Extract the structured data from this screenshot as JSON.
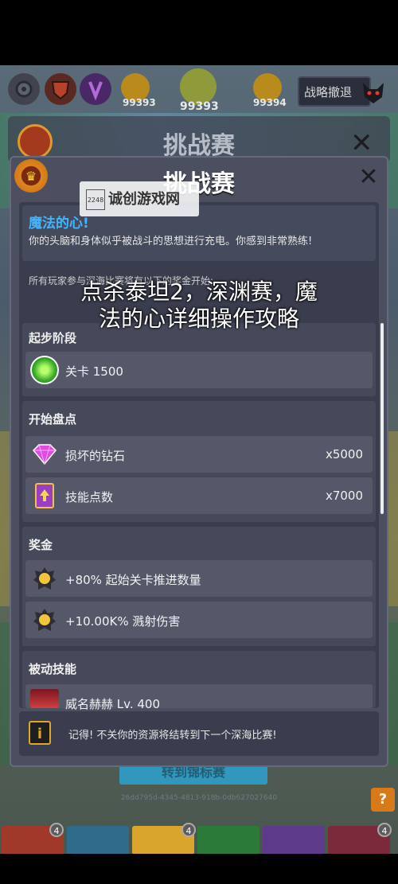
{
  "hud": {
    "coin_left": "99393",
    "coin_center": "99393",
    "coin_right": "99394",
    "retreat_label": "战略撤退"
  },
  "background_title": "挑战赛",
  "dialog": {
    "title": "挑战赛",
    "info_title": "魔法的心!",
    "info_text": "你的头脑和身体似乎被战斗的思想进行充电。你感到非常熟练!",
    "rewards_intro": "所有玩家参与深海比赛将有以下的奖金开始:",
    "start_stage": {
      "title": "起步阶段",
      "row_label": "关卡 1500"
    },
    "start_inventory": {
      "title": "开始盘点",
      "rows": [
        {
          "label": "损坏的钻石",
          "value": "x5000",
          "icon": "diamond-icon"
        },
        {
          "label": "技能点数",
          "value": "x7000",
          "icon": "skill-book-icon"
        }
      ]
    },
    "bonus": {
      "title": "奖金",
      "rows": [
        {
          "label": "+80% 起始关卡推进数量",
          "icon": "hero-token-icon"
        },
        {
          "label": "+10.00K% 溅射伤害",
          "icon": "hero-token-icon"
        }
      ]
    },
    "passive": {
      "title": "被动技能",
      "rows": [
        {
          "label": "威名赫赫 Lv. 400",
          "icon": "passive-portrait-icon"
        }
      ]
    },
    "note_text": "记得! 不关你的资源将结转到下一个深海比赛!",
    "note_icon": "i"
  },
  "behind_button_label": "转到锦标赛",
  "uuid_text": "26dd795d-4345-4813-918b-0db627027640",
  "help_label": "?",
  "bottom_badges": [
    "4",
    "4",
    "4"
  ],
  "watermark": {
    "brand": "诚创游戏网",
    "qr": [
      "2",
      "2",
      "4",
      "8"
    ]
  },
  "overlay_title": "点杀泰坦2，深渊赛，魔法的心详细操作攻略",
  "colors": {
    "accent_blue": "#3fb7ff",
    "panel": "#4c4f5f",
    "row": "#545869",
    "note_border": "#e0a626"
  }
}
